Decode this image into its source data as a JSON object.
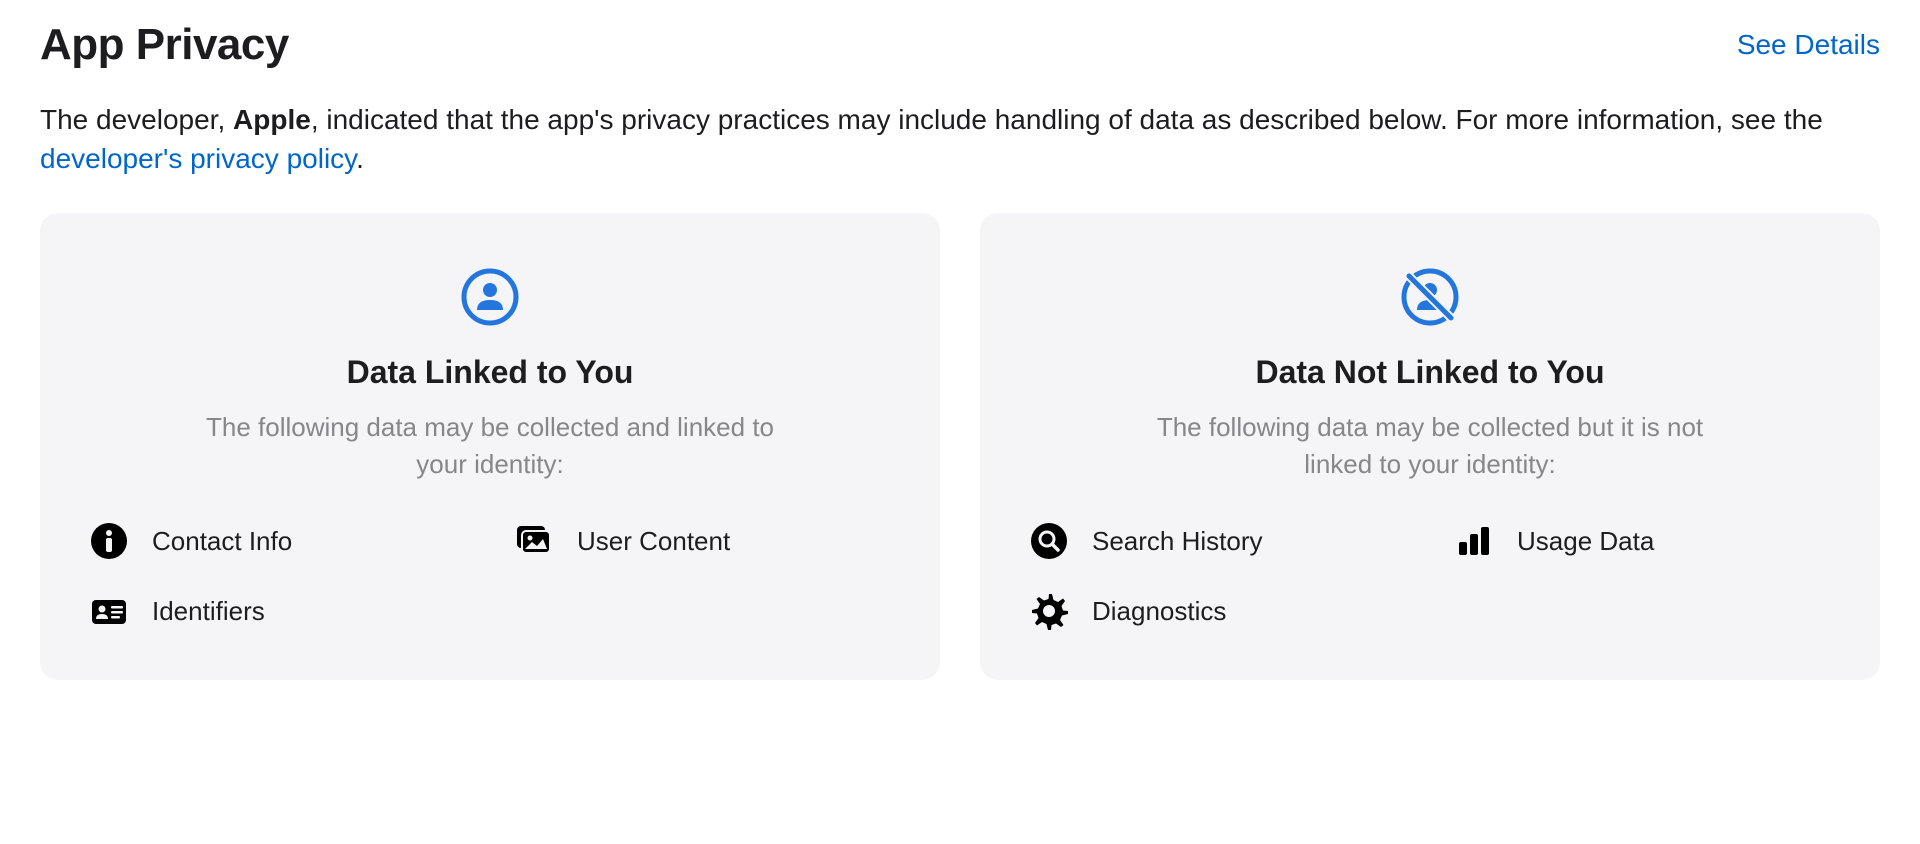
{
  "header": {
    "title": "App Privacy",
    "see_details": "See Details"
  },
  "description": {
    "prefix": "The developer, ",
    "developer_name": "Apple",
    "middle": ", indicated that the app's privacy practices may include handling of data as described below. For more information, see the ",
    "link_text": "developer's privacy policy",
    "suffix": "."
  },
  "cards": {
    "linked": {
      "title": "Data Linked to You",
      "subtitle": "The following data may be collected and linked to your identity:",
      "items": [
        {
          "label": "Contact Info",
          "icon": "info"
        },
        {
          "label": "User Content",
          "icon": "photo"
        },
        {
          "label": "Identifiers",
          "icon": "id-card"
        }
      ]
    },
    "not_linked": {
      "title": "Data Not Linked to You",
      "subtitle": "The following data may be collected but it is not linked to your identity:",
      "items": [
        {
          "label": "Search History",
          "icon": "search"
        },
        {
          "label": "Usage Data",
          "icon": "bars"
        },
        {
          "label": "Diagnostics",
          "icon": "gear"
        }
      ]
    }
  },
  "colors": {
    "accent_blue": "#0066cc",
    "icon_blue": "#2376dd",
    "text_gray": "#86868b",
    "card_bg": "#f5f5f7",
    "black": "#000000"
  }
}
